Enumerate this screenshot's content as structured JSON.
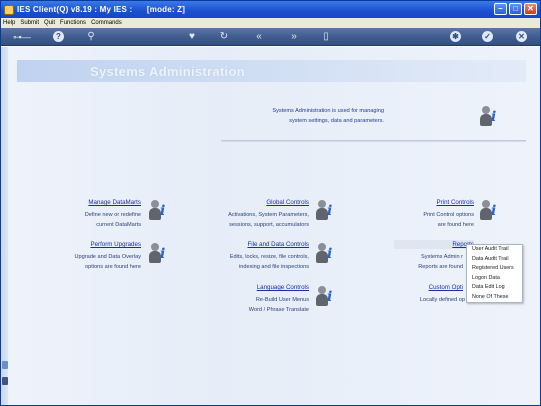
{
  "window": {
    "title": "IES Client(Q) v8.19 : My IES :      [mode: Z]",
    "controls": [
      "–",
      "□",
      "✕"
    ]
  },
  "menu": {
    "items": [
      "Help",
      "Submit",
      "Quit",
      "Functions",
      "Commands"
    ]
  },
  "toolbar": {
    "icons": [
      "key-icon",
      "help-icon",
      "search-icon",
      "heart-icon",
      "refresh-icon",
      "back-icon",
      "forward-icon",
      "clipboard-icon",
      "settings-icon",
      "check-icon",
      "close-icon"
    ]
  },
  "banner": {
    "title": "Systems Administration"
  },
  "intro": {
    "line1": "Systems Administration is used for managing",
    "line2": "system settings, data and parameters."
  },
  "items": {
    "manage_datamarts": {
      "label": "Manage DataMarts",
      "desc1": "Define new or redefine",
      "desc2": "current DataMarts"
    },
    "global_controls": {
      "label": "Global Controls",
      "desc1": "Activations, System Parameters,",
      "desc2": "sessions, support, accumulators"
    },
    "print_controls": {
      "label": "Print Controls",
      "desc1": "Print Control options",
      "desc2": "are found here"
    },
    "perform_upgrades": {
      "label": "Perform Upgrades",
      "desc1": "Upgrade and Data Overlay",
      "desc2": "options are found here"
    },
    "file_data_controls": {
      "label": "File and Data Controls",
      "desc1": "Edits, locks, resize, file controls,",
      "desc2": "indexing and file inspections"
    },
    "reports": {
      "label": "Reports",
      "desc1": "Systems Admin r",
      "desc2": "Reports are found"
    },
    "language_controls": {
      "label": "Language Controls",
      "desc1": "Re-Build User Menus",
      "desc2": "Word / Phrase Translate"
    },
    "custom_options": {
      "label": "Custom Opti",
      "desc1": "Locally defined op"
    }
  },
  "popup_menu": {
    "items": [
      "User Audit Trail",
      "Data Audit Trail",
      "Registered Users",
      "Logon Data",
      "Data Edit Log",
      "None Of These"
    ]
  }
}
